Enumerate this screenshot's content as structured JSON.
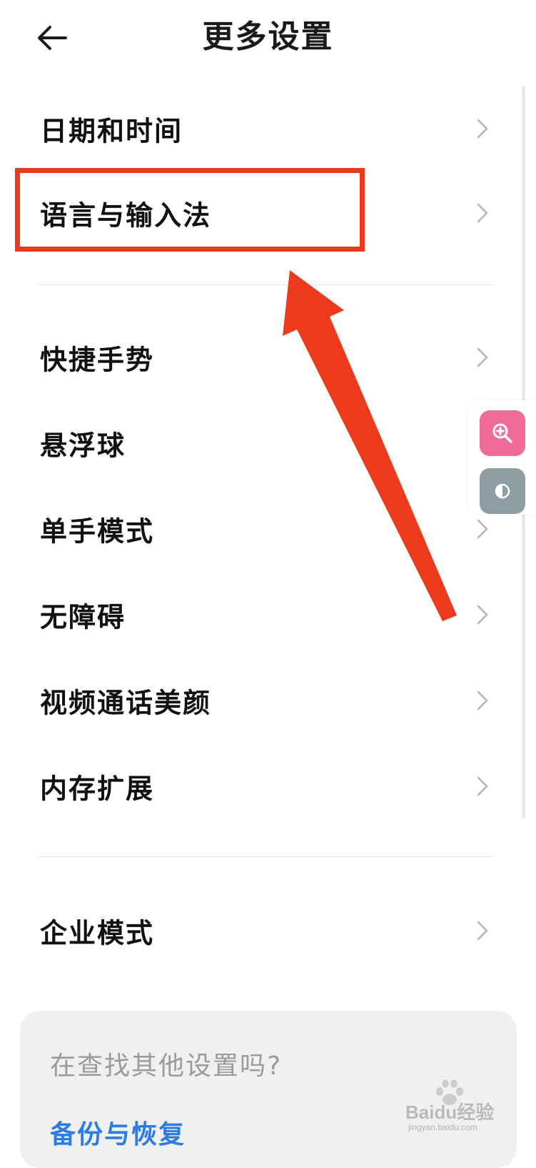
{
  "header": {
    "title": "更多设置",
    "back_icon": "arrow-left-icon"
  },
  "settings": {
    "group1": [
      {
        "label": "日期和时间"
      },
      {
        "label": "语言与输入法"
      }
    ],
    "group2": [
      {
        "label": "快捷手势"
      },
      {
        "label": "悬浮球"
      },
      {
        "label": "单手模式"
      },
      {
        "label": "无障碍"
      },
      {
        "label": "视频通话美颜"
      },
      {
        "label": "内存扩展"
      }
    ],
    "group3": [
      {
        "label": "企业模式"
      }
    ]
  },
  "suggestion_card": {
    "title": "在查找其他设置吗?",
    "link": "备份与恢复"
  },
  "floating_tools": {
    "zoom_icon": "zoom-in-icon",
    "contrast_icon": "contrast-icon"
  },
  "watermark": {
    "brand": "Baidu经验",
    "url": "jingyan.baidu.com"
  },
  "colors": {
    "annotation_red": "#ee3a1c",
    "link_blue": "#2d7be5",
    "zoom_pink": "#f06b9a",
    "contrast_gray": "#8e9ea3"
  }
}
